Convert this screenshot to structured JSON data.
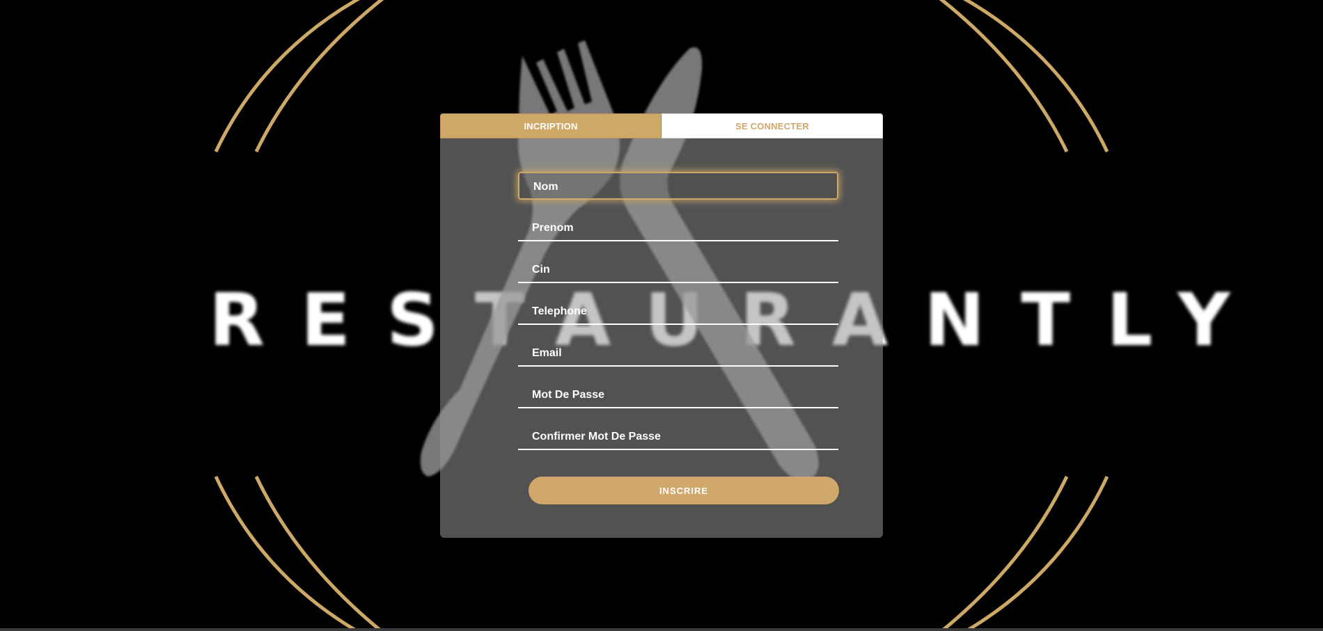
{
  "brand": {
    "logo_text": "RESTAURANTLY",
    "accent_color": "#cda867"
  },
  "tabs": [
    {
      "label": "INCRIPTION",
      "active": true
    },
    {
      "label": "SE CONNECTER",
      "active": false
    }
  ],
  "form": {
    "fields": [
      {
        "label": "Nom"
      },
      {
        "label": "Prenom"
      },
      {
        "label": "Cin"
      },
      {
        "label": "Telephone"
      },
      {
        "label": "Email"
      },
      {
        "label": "Mot De Passe"
      },
      {
        "label": "Confirmer Mot De Passe"
      }
    ],
    "submit_label": "INSCRIRE"
  },
  "icons": [
    "fork-icon",
    "knife-icon"
  ]
}
